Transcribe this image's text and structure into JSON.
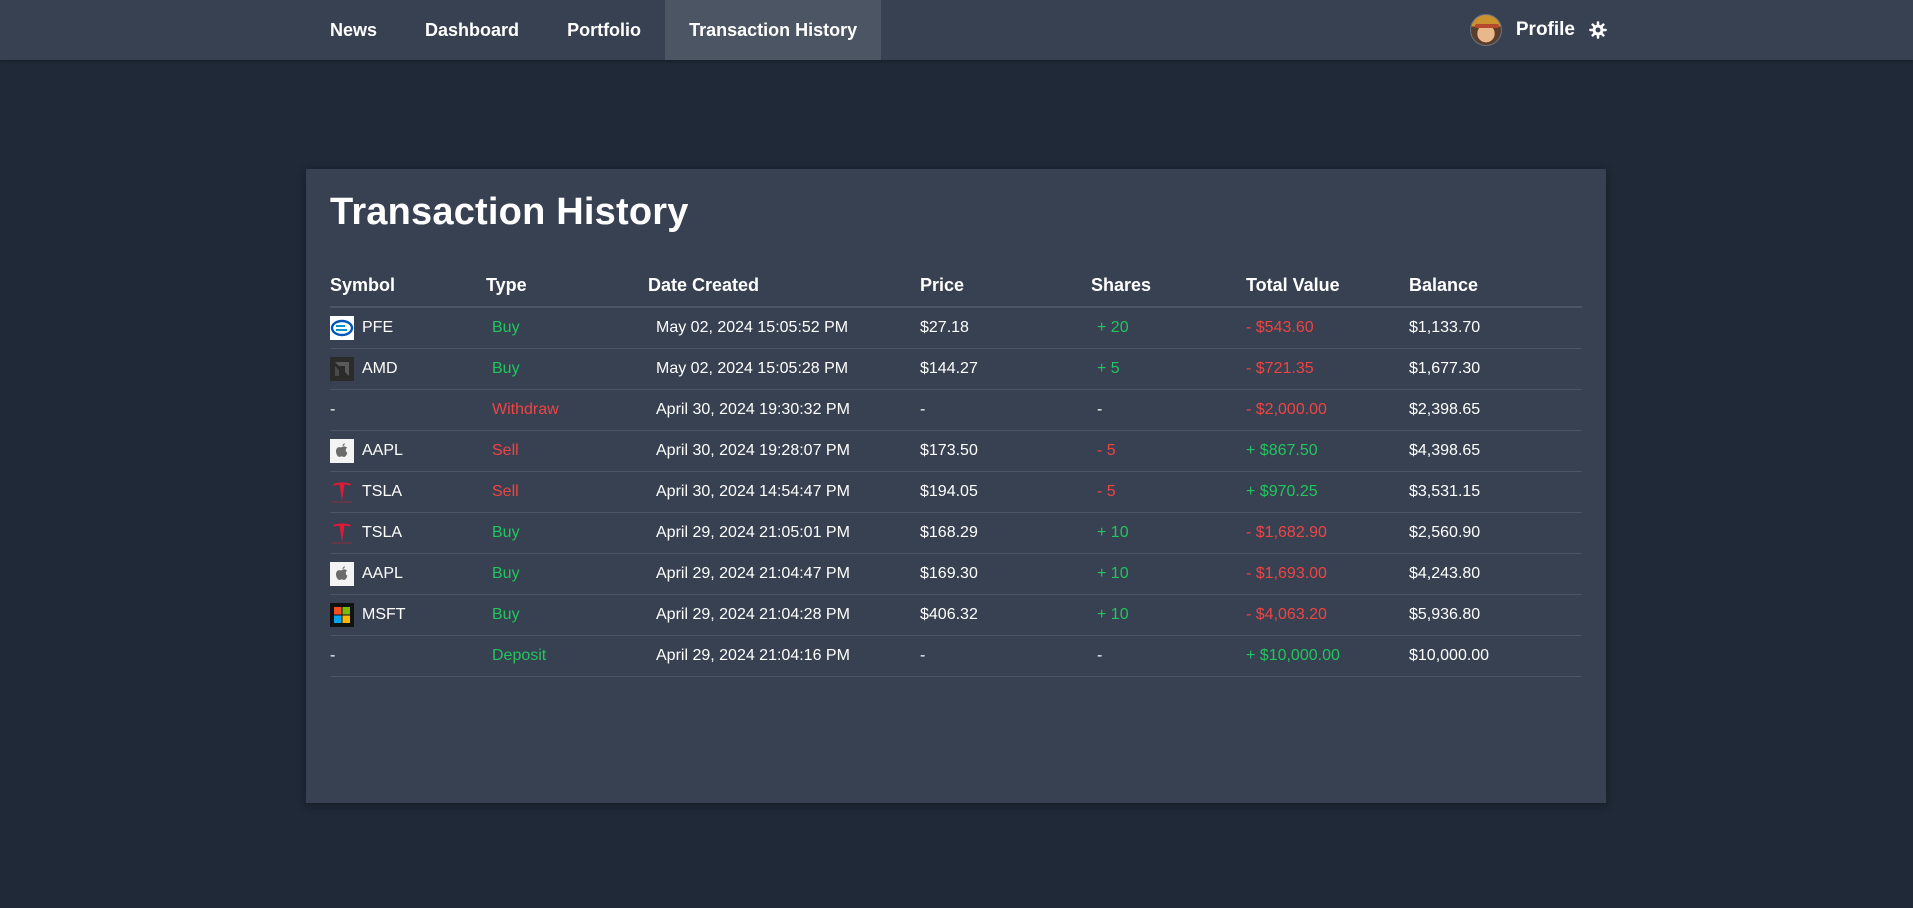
{
  "nav": {
    "links": [
      "News",
      "Dashboard",
      "Portfolio",
      "Transaction History"
    ],
    "active": "Transaction History",
    "profile_label": "Profile",
    "avatar_icon": "avatar-icon",
    "settings_icon": "gear-icon"
  },
  "page": {
    "title": "Transaction History"
  },
  "table": {
    "headers": [
      "Symbol",
      "Type",
      "Date Created",
      "Price",
      "Shares",
      "Total Value",
      "Balance"
    ],
    "rows": [
      {
        "symbol": "PFE",
        "logo": "pfe-logo-icon",
        "type": "Buy",
        "type_color": "green",
        "date": "May 02, 2024 15:05:52 PM",
        "price": "$27.18",
        "shares": "+ 20",
        "shares_color": "green",
        "total": "- $543.60",
        "total_color": "red",
        "balance": "$1,133.70"
      },
      {
        "symbol": "AMD",
        "logo": "amd-logo-icon",
        "type": "Buy",
        "type_color": "green",
        "date": "May 02, 2024 15:05:28 PM",
        "price": "$144.27",
        "shares": "+ 5",
        "shares_color": "green",
        "total": "- $721.35",
        "total_color": "red",
        "balance": "$1,677.30"
      },
      {
        "symbol": "-",
        "logo": "",
        "type": "Withdraw",
        "type_color": "red",
        "date": "April 30, 2024 19:30:32 PM",
        "price": "-",
        "shares": "-",
        "shares_color": "white",
        "total": "- $2,000.00",
        "total_color": "red",
        "balance": "$2,398.65"
      },
      {
        "symbol": "AAPL",
        "logo": "apple-logo-icon",
        "type": "Sell",
        "type_color": "red",
        "date": "April 30, 2024 19:28:07 PM",
        "price": "$173.50",
        "shares": "- 5",
        "shares_color": "red",
        "total": "+ $867.50",
        "total_color": "green",
        "balance": "$4,398.65"
      },
      {
        "symbol": "TSLA",
        "logo": "tesla-logo-icon",
        "type": "Sell",
        "type_color": "red",
        "date": "April 30, 2024 14:54:47 PM",
        "price": "$194.05",
        "shares": "- 5",
        "shares_color": "red",
        "total": "+ $970.25",
        "total_color": "green",
        "balance": "$3,531.15"
      },
      {
        "symbol": "TSLA",
        "logo": "tesla-logo-icon",
        "type": "Buy",
        "type_color": "green",
        "date": "April 29, 2024 21:05:01 PM",
        "price": "$168.29",
        "shares": "+ 10",
        "shares_color": "green",
        "total": "- $1,682.90",
        "total_color": "red",
        "balance": "$2,560.90"
      },
      {
        "symbol": "AAPL",
        "logo": "apple-logo-icon",
        "type": "Buy",
        "type_color": "green",
        "date": "April 29, 2024 21:04:47 PM",
        "price": "$169.30",
        "shares": "+ 10",
        "shares_color": "green",
        "total": "- $1,693.00",
        "total_color": "red",
        "balance": "$4,243.80"
      },
      {
        "symbol": "MSFT",
        "logo": "msft-logo-icon",
        "type": "Buy",
        "type_color": "green",
        "date": "April 29, 2024 21:04:28 PM",
        "price": "$406.32",
        "shares": "+ 10",
        "shares_color": "green",
        "total": "- $4,063.20",
        "total_color": "red",
        "balance": "$5,936.80"
      },
      {
        "symbol": "-",
        "logo": "",
        "type": "Deposit",
        "type_color": "green",
        "date": "April 29, 2024 21:04:16 PM",
        "price": "-",
        "shares": "-",
        "shares_color": "white",
        "total": "+ $10,000.00",
        "total_color": "green",
        "balance": "$10,000.00"
      }
    ]
  },
  "colors": {
    "background": "#1f2937",
    "surface": "#374151",
    "nav_active": "#4b5563",
    "positive": "#22c55e",
    "negative": "#ef4444"
  }
}
